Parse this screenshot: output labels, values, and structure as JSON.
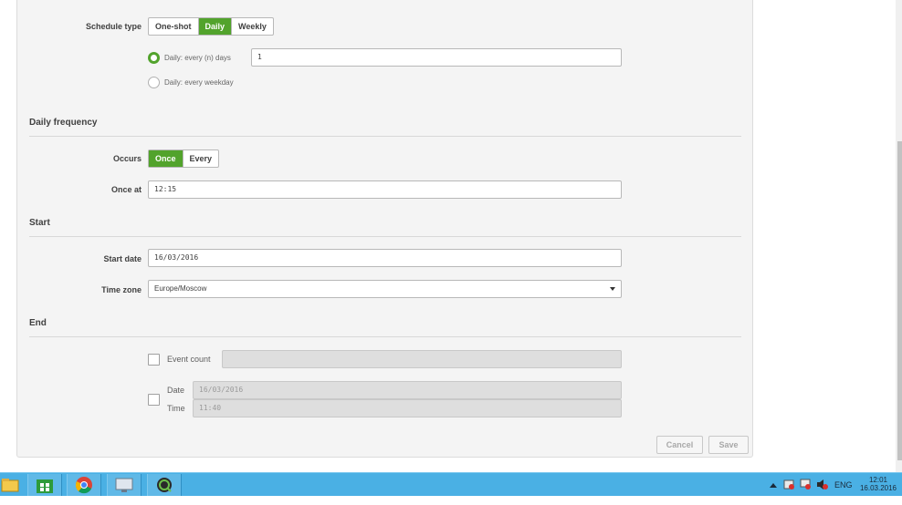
{
  "schedule": {
    "type_label": "Schedule type",
    "types": [
      "One-shot",
      "Daily",
      "Weekly"
    ],
    "active_type": "Daily",
    "daily_options": [
      {
        "label": "Daily: every (n) days",
        "checked": true
      },
      {
        "label": "Daily: every weekday",
        "checked": false
      }
    ],
    "every_n_days_value": "1"
  },
  "daily_frequency": {
    "title": "Daily frequency",
    "occurs_label": "Occurs",
    "occurs_options": [
      "Once",
      "Every"
    ],
    "active_occurs": "Once",
    "once_at_label": "Once at",
    "once_at_value": "12:15"
  },
  "start": {
    "title": "Start",
    "start_date_label": "Start date",
    "start_date_value": "16/03/2016",
    "time_zone_label": "Time zone",
    "time_zone_value": "Europe/Moscow"
  },
  "end": {
    "title": "End",
    "event_count_label": "Event count",
    "event_count_value": "",
    "date_label": "Date",
    "date_value": "16/03/2016",
    "time_label": "Time",
    "time_value": "11:40"
  },
  "actions": {
    "cancel_label": "Cancel",
    "save_label": "Save"
  },
  "taskbar": {
    "apps": [
      "file-explorer-icon",
      "store-icon",
      "chrome-icon",
      "remote-desktop-icon",
      "qlik-icon"
    ],
    "language": "ENG",
    "time": "12:01",
    "date": "16.03.2016"
  },
  "colors": {
    "accent": "#52a32c",
    "taskbar": "#4ab0e4",
    "panel": "#f4f4f4"
  }
}
